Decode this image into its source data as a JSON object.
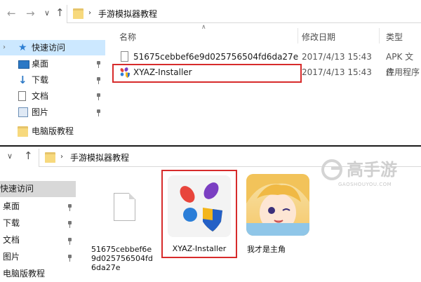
{
  "top": {
    "breadcrumb_folder": "手游模拟器教程",
    "columns": {
      "name": "名称",
      "date": "修改日期",
      "type": "类型"
    },
    "sidebar": [
      {
        "label": "快速访问",
        "icon": "star-icon",
        "pinned": false
      },
      {
        "label": "桌面",
        "icon": "desktop-icon",
        "pinned": true
      },
      {
        "label": "下载",
        "icon": "download-icon",
        "pinned": true
      },
      {
        "label": "文档",
        "icon": "document-icon",
        "pinned": true
      },
      {
        "label": "图片",
        "icon": "picture-icon",
        "pinned": true
      },
      {
        "label": "电脑版教程",
        "icon": "folder-icon",
        "pinned": false
      }
    ],
    "files": [
      {
        "name": "51675cebbef6e9d025756504fd6da27e",
        "date": "2017/4/13 15:43",
        "type": "APK 文件",
        "icon": "blank-file-icon"
      },
      {
        "name": "XYAZ-Installer",
        "date": "2017/4/13 15:43",
        "type": "应用程序",
        "icon": "xyaz-app-icon"
      }
    ]
  },
  "bottom": {
    "breadcrumb_folder": "手游模拟器教程",
    "sidebar": [
      {
        "label": "快速访问",
        "pinned": false
      },
      {
        "label": "桌面",
        "pinned": true
      },
      {
        "label": "下载",
        "pinned": true
      },
      {
        "label": "文档",
        "pinned": true
      },
      {
        "label": "图片",
        "pinned": true
      },
      {
        "label": "电脑版教程",
        "pinned": false
      }
    ],
    "tiles": {
      "apk_line1": "51675cebbef6e",
      "apk_line2": "9d025756504fd",
      "apk_line3": "6da27e",
      "installer": "XYAZ-Installer",
      "game": "我才是主角"
    }
  },
  "watermark": {
    "brand": "高手游",
    "domain": "GAOSHOUYOU.COM"
  },
  "colors": {
    "selection": "#cce8ff",
    "highlight": "#d72b2b",
    "folder": "#f7d97d"
  }
}
